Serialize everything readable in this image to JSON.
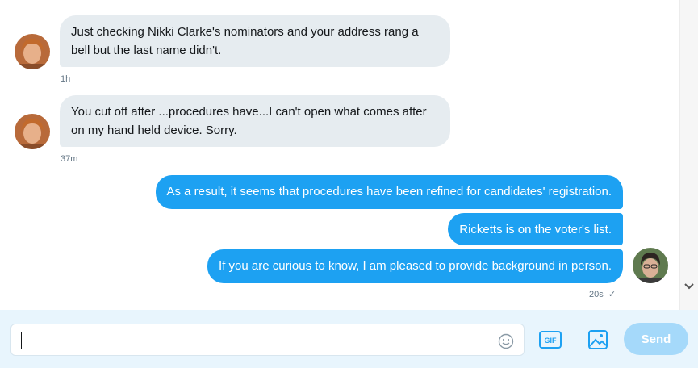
{
  "messages": [
    {
      "text": "Just checking Nikki Clarke's nominators and your address rang a bell but the last name didn't.",
      "time": "1h"
    },
    {
      "text": "You cut off after ...procedures have...I can't open what comes after on my hand held device. Sorry.",
      "time": "37m"
    },
    {
      "text": "As a result, it seems that procedures have been refined for candidates' registration."
    },
    {
      "text": "Ricketts is on the voter's list."
    },
    {
      "text": "If you are curious to know, I am pleased to provide background in person.",
      "time": "20s",
      "status": "✓"
    }
  ],
  "composer": {
    "value": "",
    "gif_label": "GIF",
    "send_label": "Send"
  },
  "colors": {
    "incoming_bubble": "#e6ecf0",
    "outgoing_bubble": "#1da1f2",
    "composer_bg": "#e8f5fd",
    "send_disabled": "#a5d9fa",
    "icon": "#1da1f2"
  },
  "icons": {
    "emoji": "smiley-icon",
    "gif": "gif-icon",
    "image": "image-icon",
    "scroll": "chevron-down-icon"
  }
}
